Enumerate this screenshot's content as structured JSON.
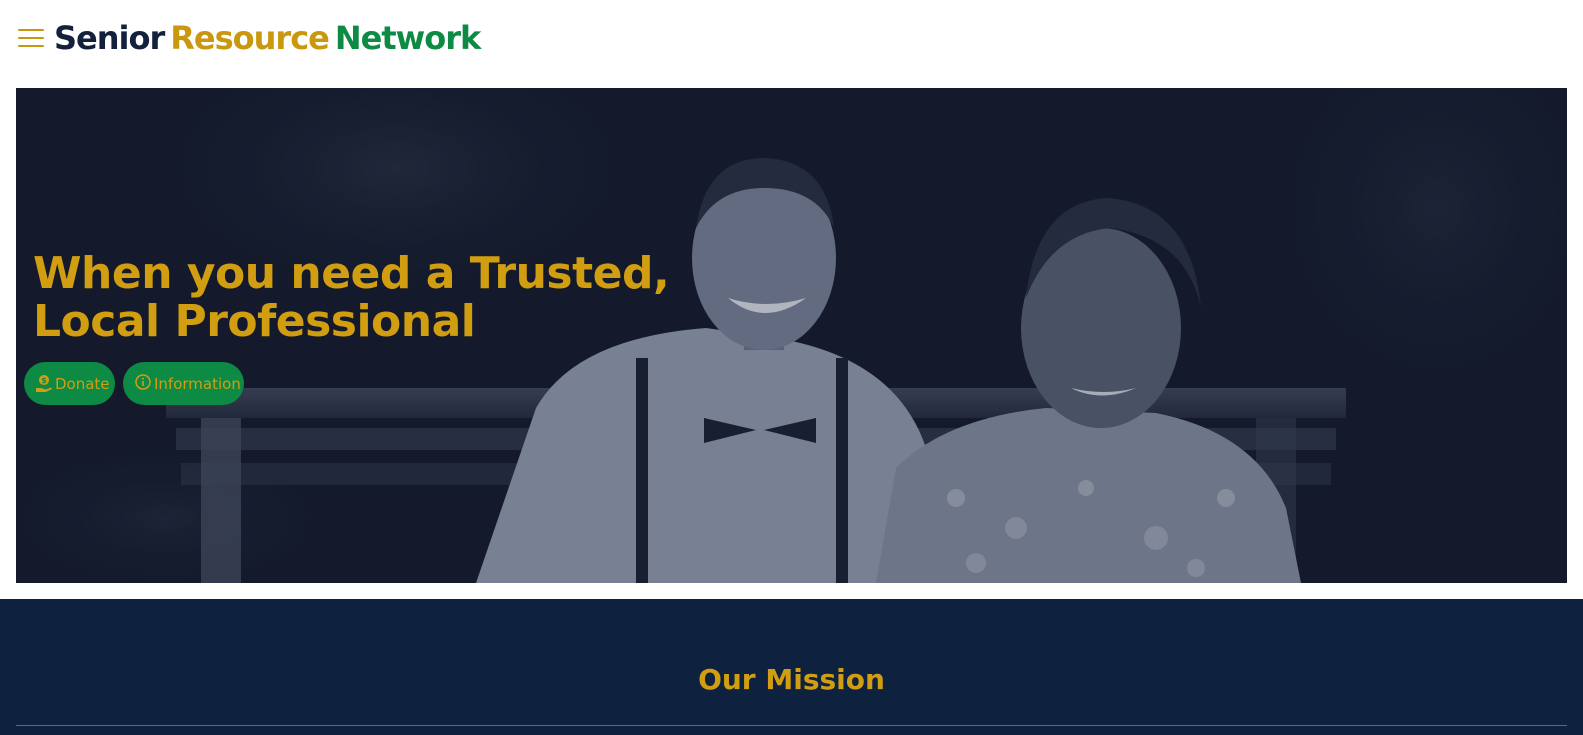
{
  "header": {
    "menu_icon": "hamburger-icon",
    "logo": {
      "word1": "Senior",
      "word2": "Resource",
      "word3": "Network"
    }
  },
  "hero": {
    "title_line1": "When you need a Trusted,",
    "title_line2": "Local Professional",
    "buttons": {
      "donate_label": "Donate",
      "donate_icon": "hand-coin-icon",
      "info_label": "Information",
      "info_icon": "info-circle-icon"
    }
  },
  "mission": {
    "title": "Our Mission"
  },
  "colors": {
    "navy": "#0e2240",
    "gold": "#d19e11",
    "green": "#0d8a43",
    "hero_overlay": "#141a2d"
  }
}
